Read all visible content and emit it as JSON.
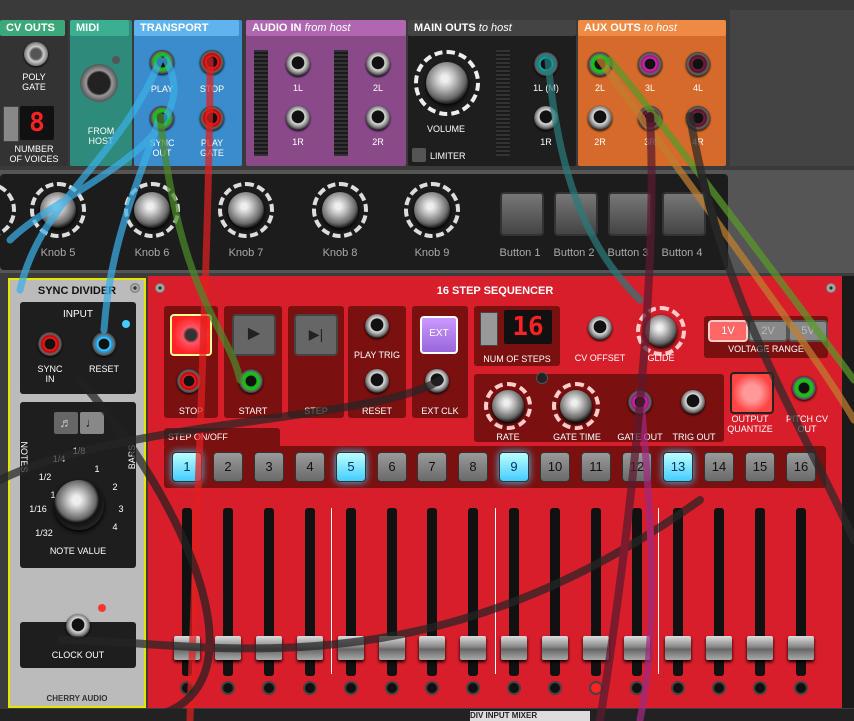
{
  "top_row": {
    "cv_outs": {
      "title": "CV OUTS",
      "poly_gate": "POLY\nGATE",
      "number_of_voices": "NUMBER\nOF VOICES",
      "voices_display": "8"
    },
    "midi": {
      "title": "MIDI",
      "from_host": "FROM\nHOST"
    },
    "transport": {
      "title": "TRANSPORT",
      "play": "PLAY",
      "stop": "STOP",
      "sync_out": "SYNC\nOUT",
      "play_gate": "PLAY\nGATE"
    },
    "audio_in": {
      "title": "AUDIO IN",
      "subtitle": "from host",
      "j1l": "1L",
      "j1r": "1R",
      "j2l": "2L",
      "j2r": "2R"
    },
    "main_outs": {
      "title": "MAIN OUTS",
      "subtitle": "to host",
      "volume": "VOLUME",
      "limiter": "LIMITER",
      "out1l": "1L (M)",
      "out1r": "1R"
    },
    "aux_outs": {
      "title": "AUX OUTS",
      "subtitle": "to host",
      "l2": "2L",
      "l3": "3L",
      "l4": "4L",
      "r2": "2R",
      "r3": "3R",
      "r4": "4R"
    }
  },
  "knob_row": {
    "knobs": [
      "Knob 5",
      "Knob 6",
      "Knob 7",
      "Knob 8",
      "Knob 9"
    ],
    "buttons": [
      "Button 1",
      "Button 2",
      "Button 3",
      "Button 4"
    ]
  },
  "sync_divider": {
    "title": "SYNC DIVIDER",
    "input": "INPUT",
    "sync_in": "SYNC\nIN",
    "reset": "RESET",
    "notes": "NOTES",
    "bars": "BARS",
    "values": [
      "1",
      "1/2",
      "1/4",
      "1/8",
      "1/16",
      "1/32",
      "1",
      "2",
      "3",
      "4"
    ],
    "note_value": "NOTE VALUE",
    "clock_out": "CLOCK OUT",
    "brand": "CHERRY AUDIO"
  },
  "sequencer": {
    "title": "16 STEP SEQUENCER",
    "stop": "STOP",
    "start": "START",
    "step": "STEP",
    "play_trig": "PLAY TRIG",
    "reset": "RESET",
    "ext": "EXT",
    "ext_clk": "EXT CLK",
    "num_steps": "NUM OF STEPS",
    "num_steps_value": "16",
    "cv_offset": "CV OFFSET",
    "glide": "GLIDE",
    "voltage_range": "VOLTAGE RANGE",
    "ranges": [
      "1V",
      "2V",
      "5V"
    ],
    "selected_range": "1V",
    "rate": "RATE",
    "gate_time": "GATE TIME",
    "gate_out": "GATE OUT",
    "trig_out": "TRIG OUT",
    "output_quantize": "OUTPUT\nQUANTIZE",
    "pitch_cv_out": "PITCH CV\nOUT",
    "step_on_off": "STEP ON/OFF",
    "steps": [
      "1",
      "2",
      "3",
      "4",
      "5",
      "6",
      "7",
      "8",
      "9",
      "10",
      "11",
      "12",
      "13",
      "14",
      "15",
      "16"
    ],
    "steps_on": [
      1,
      5,
      9,
      13
    ],
    "fader_levels": [
      0.08,
      0.08,
      0.08,
      0.08,
      0.08,
      0.08,
      0.08,
      0.08,
      0.08,
      0.08,
      0.08,
      0.08,
      0.08,
      0.08,
      0.08,
      0.08
    ],
    "active_led": 11
  },
  "bottom_row": {
    "partial_title": "DIV INPUT MIXER"
  }
}
